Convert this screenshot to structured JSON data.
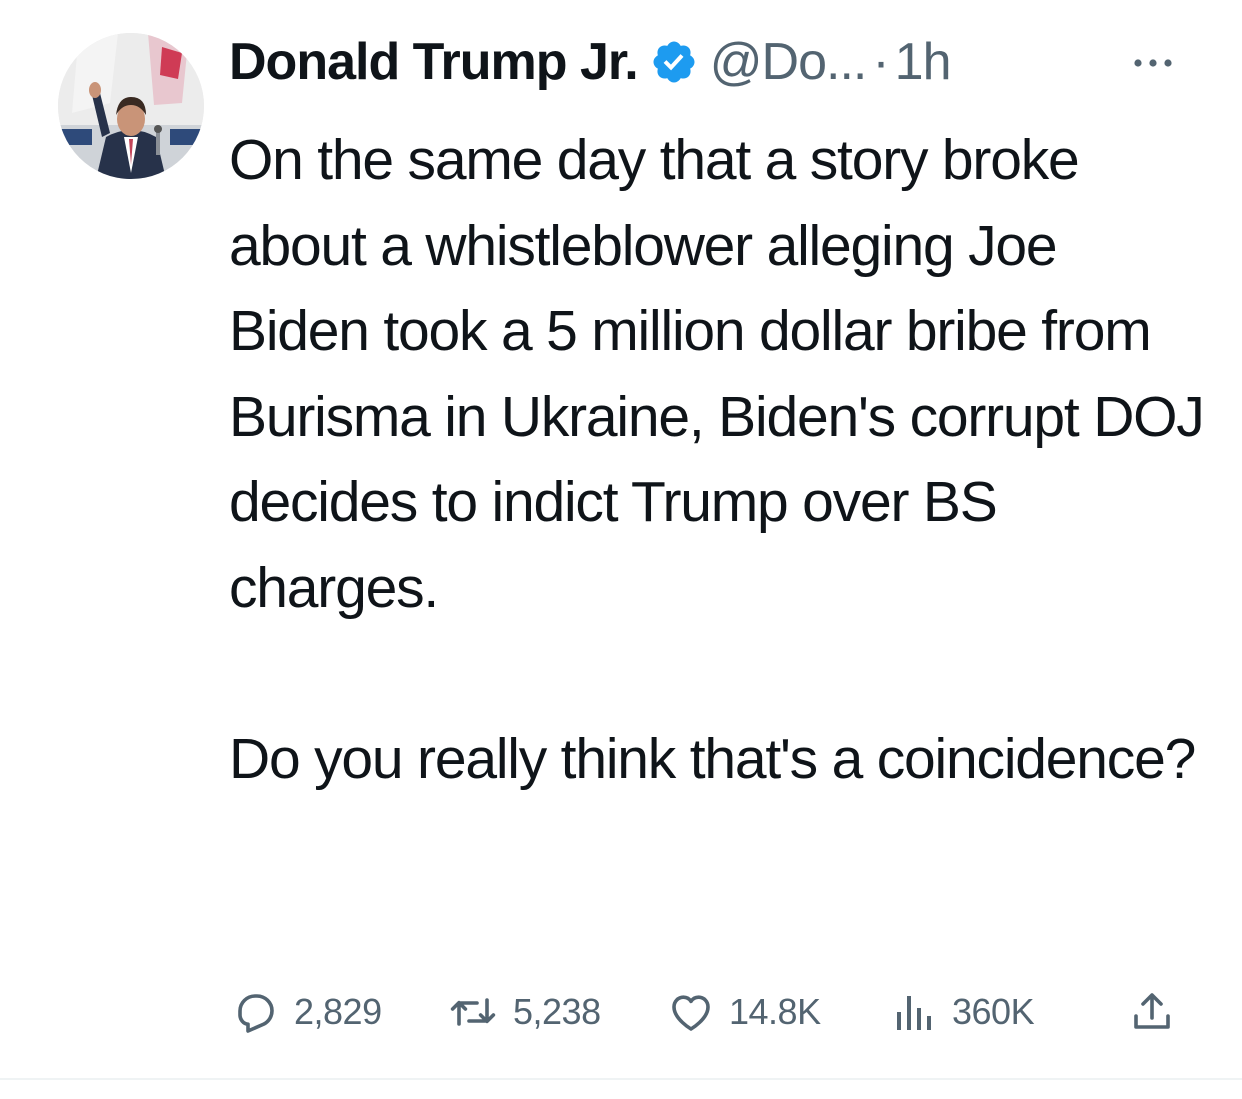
{
  "tweet": {
    "display_name": "Donald Trump Jr.",
    "handle": "@Do...",
    "separator": "·",
    "time": "1h",
    "verified_icon": "verified-badge-icon",
    "verified_color": "#1d9bf0",
    "body": "On the same day that a story broke about a whistleblower alleging Joe Biden took a 5 million dollar bribe from Burisma in Ukraine, Biden's corrupt DOJ decides to indict Trump over BS charges.\n\nDo you really think that's a coincidence?"
  },
  "actions": {
    "reply": {
      "icon": "reply-icon",
      "count": "2,829"
    },
    "retweet": {
      "icon": "retweet-icon",
      "count": "5,238"
    },
    "like": {
      "icon": "heart-icon",
      "count": "14.8K"
    },
    "views": {
      "icon": "views-icon",
      "count": "360K"
    },
    "share": {
      "icon": "share-icon"
    }
  },
  "colors": {
    "text_primary": "#0f1419",
    "text_secondary": "#536471",
    "accent": "#1d9bf0"
  }
}
